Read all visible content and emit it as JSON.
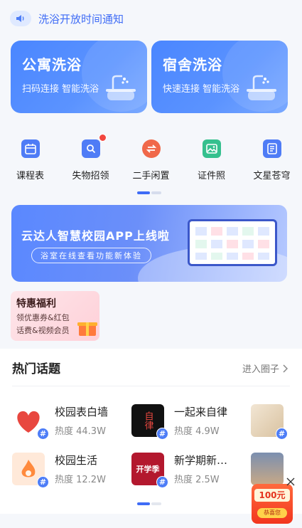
{
  "notice": {
    "text": "洗浴开放时间通知",
    "icon": "speaker-icon"
  },
  "shower_cards": [
    {
      "title": "公寓洗浴",
      "subtitle": "扫码连接 智能洗浴",
      "icon": "bathtub-icon"
    },
    {
      "title": "宿舍洗浴",
      "subtitle": "快速连接 智能洗浴",
      "icon": "bathtub-icon"
    }
  ],
  "shortcuts": [
    {
      "label": "课程表",
      "icon": "calendar-icon",
      "color": "#4f7cf6"
    },
    {
      "label": "失物招领",
      "icon": "search-bag-icon",
      "color": "#4f7cf6",
      "badge": true
    },
    {
      "label": "二手闲置",
      "icon": "exchange-icon",
      "color": "#f0684a"
    },
    {
      "label": "证件照",
      "icon": "photo-icon",
      "color": "#35c08e"
    },
    {
      "label": "文星苍穹",
      "icon": "document-icon",
      "color": "#4f7cf6"
    }
  ],
  "banner": {
    "title": "云达人智慧校园APP上线啦",
    "subtitle": "浴室在线查看功能新体验"
  },
  "promo": {
    "title": "特惠福利",
    "line1": "领优惠券&红包",
    "line2": "话费&视频会员"
  },
  "topics": {
    "heading": "热门话题",
    "more": "进入圈子",
    "items": [
      {
        "name": "校园表白墙",
        "heat": "热度 44.3W"
      },
      {
        "name": "一起来自律",
        "heat": "热度 4.9W",
        "thumb_text": "自律"
      },
      {
        "name": "校园生活",
        "heat": "热度 12.2W"
      },
      {
        "name": "新学期新…",
        "heat": "热度 2.5W",
        "thumb_text": "开学季"
      }
    ]
  },
  "floating_coupon": {
    "amount": "100元",
    "button": "恭喜您"
  },
  "colors": {
    "accent": "#3f6cf6",
    "card": "#4a86ff",
    "badge": "#f2463f"
  }
}
